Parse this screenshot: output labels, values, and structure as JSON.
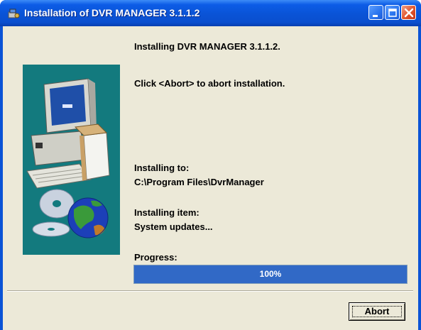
{
  "window": {
    "title": "Installation of DVR MANAGER 3.1.1.2",
    "app_icon": "installer-icon",
    "controls": {
      "minimize": "minimize-icon",
      "maximize": "maximize-icon",
      "close": "close-icon"
    }
  },
  "content": {
    "heading": "Installing DVR MANAGER 3.1.1.2.",
    "abort_hint": "Click <Abort> to abort installation.",
    "install_to_label": "Installing to:",
    "install_to_value": "C:\\Program Files\\DvrManager",
    "item_label": "Installing item:",
    "item_value": "System updates...",
    "progress_label": "Progress:",
    "progress_text": "100%",
    "progress_percent": 100
  },
  "graphic": {
    "description_icons": [
      "computer-icon",
      "cd-icon",
      "globe-icon"
    ]
  },
  "buttons": {
    "abort": "Abort"
  },
  "colors": {
    "titlebar": "#0a53d6",
    "client": "#ece9d8",
    "graphic_panel": "#137a7e",
    "progress_fill": "#3169c6"
  }
}
